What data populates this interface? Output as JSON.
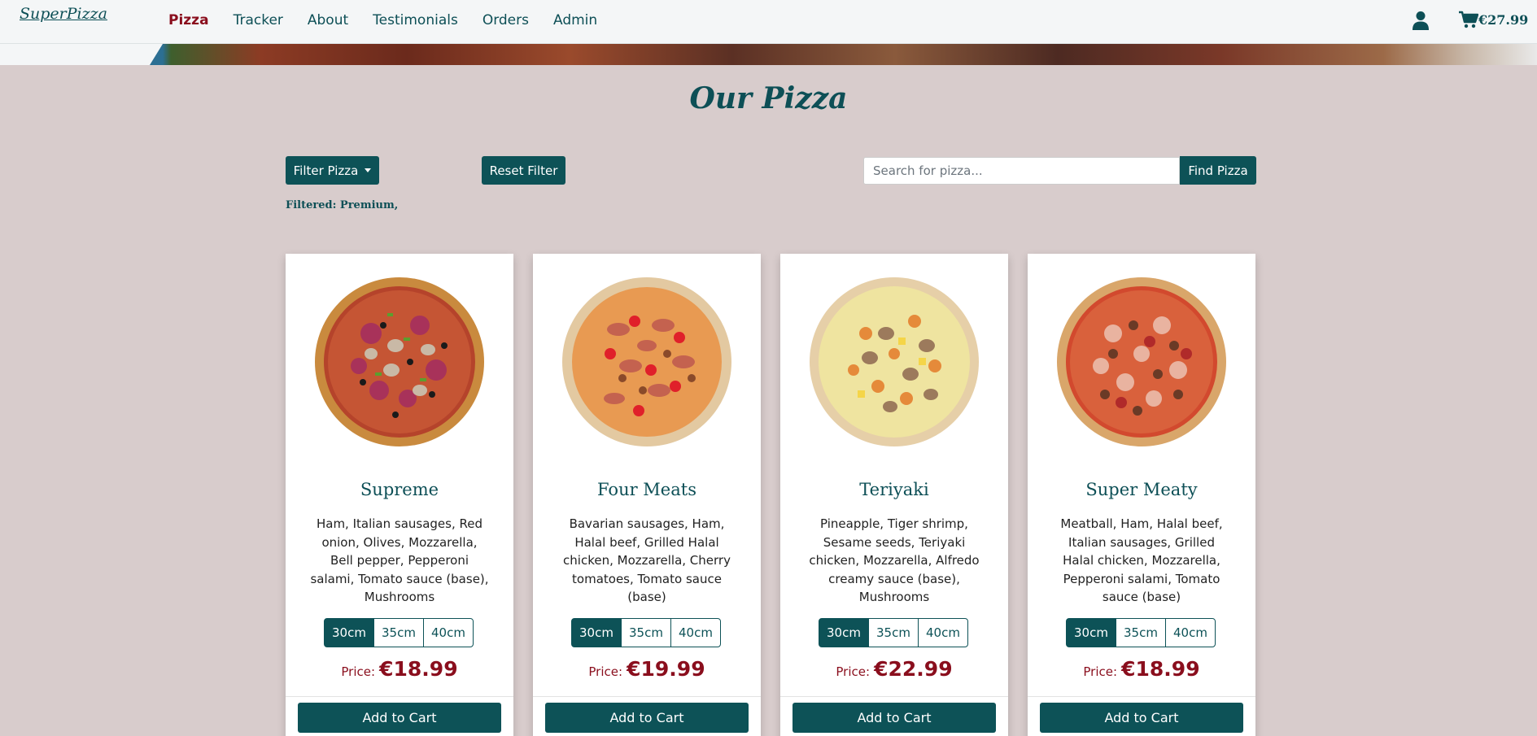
{
  "brand": "SuperPizza",
  "nav": {
    "links": [
      {
        "label": "Pizza",
        "active": true
      },
      {
        "label": "Tracker"
      },
      {
        "label": "About"
      },
      {
        "label": "Testimonials"
      },
      {
        "label": "Orders"
      },
      {
        "label": "Admin"
      }
    ]
  },
  "header_icons": {
    "user": "user-icon",
    "cart": "cart-icon"
  },
  "cart": {
    "total": "€27.99"
  },
  "page": {
    "title": "Our Pizza"
  },
  "controls": {
    "filter_label": "Filter Pizza",
    "reset_label": "Reset Filter",
    "search_placeholder": "Search for pizza...",
    "find_label": "Find Pizza",
    "filtered_text": "Filtered: Premium,"
  },
  "colors": {
    "primary": "#0d5257",
    "accent": "#8a0e1d",
    "background": "#d8cccc"
  },
  "pizzas": [
    {
      "name": "Supreme",
      "description": "Ham, Italian sausages, Red onion, Olives, Mozzarella, Bell pepper, Pepperoni salami, Tomato sauce (base), Mushrooms",
      "sizes": [
        "30cm",
        "35cm",
        "40cm"
      ],
      "selected_size": "30cm",
      "price_label": "Price:",
      "price": "€18.99",
      "add_label": "Add to Cart"
    },
    {
      "name": "Four Meats",
      "description": "Bavarian sausages, Ham, Halal beef, Grilled Halal chicken, Mozzarella, Cherry tomatoes, Tomato sauce (base)",
      "sizes": [
        "30cm",
        "35cm",
        "40cm"
      ],
      "selected_size": "30cm",
      "price_label": "Price:",
      "price": "€19.99",
      "add_label": "Add to Cart"
    },
    {
      "name": "Teriyaki",
      "description": "Pineapple, Tiger shrimp, Sesame seeds, Teriyaki chicken, Mozzarella, Alfredo creamy sauce (base), Mushrooms",
      "sizes": [
        "30cm",
        "35cm",
        "40cm"
      ],
      "selected_size": "30cm",
      "price_label": "Price:",
      "price": "€22.99",
      "add_label": "Add to Cart"
    },
    {
      "name": "Super Meaty",
      "description": "Meatball, Ham, Halal beef, Italian sausages, Grilled Halal chicken, Mozzarella, Pepperoni salami, Tomato sauce (base)",
      "sizes": [
        "30cm",
        "35cm",
        "40cm"
      ],
      "selected_size": "30cm",
      "price_label": "Price:",
      "price": "€18.99",
      "add_label": "Add to Cart"
    }
  ]
}
